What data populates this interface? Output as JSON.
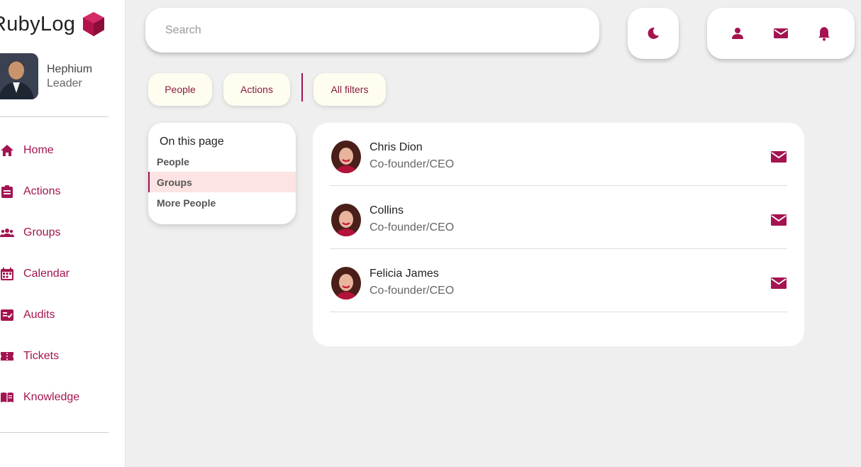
{
  "app": {
    "name": "RubyLog"
  },
  "profile": {
    "name": "Hephium",
    "role": "Leader"
  },
  "nav": {
    "items": [
      {
        "label": "Home",
        "icon": "home-icon"
      },
      {
        "label": "Actions",
        "icon": "clipboard-icon"
      },
      {
        "label": "Groups",
        "icon": "groups-icon"
      },
      {
        "label": "Calendar",
        "icon": "calendar-icon"
      },
      {
        "label": "Audits",
        "icon": "checklist-icon"
      },
      {
        "label": "Tickets",
        "icon": "ticket-icon"
      },
      {
        "label": "Knowledge",
        "icon": "book-icon"
      }
    ]
  },
  "search": {
    "placeholder": "Search"
  },
  "toolbar": {
    "theme_icon": "moon-icon",
    "icons": [
      "user-icon",
      "mail-icon",
      "bell-icon"
    ]
  },
  "filters": {
    "chips": [
      "People",
      "Actions",
      "All filters"
    ]
  },
  "toc": {
    "title": "On this page",
    "items": [
      "People",
      "Groups",
      "More People"
    ],
    "active": "Groups"
  },
  "people": [
    {
      "name": "Chris Dion",
      "role": "Co-founder/CEO"
    },
    {
      "name": "Collins",
      "role": "Co-founder/CEO"
    },
    {
      "name": "Felicia James",
      "role": "Co-founder/CEO"
    }
  ],
  "colors": {
    "accent": "#a41450",
    "background": "#efefef",
    "chip": "#fffdf0",
    "active_row": "#fde3e3"
  }
}
